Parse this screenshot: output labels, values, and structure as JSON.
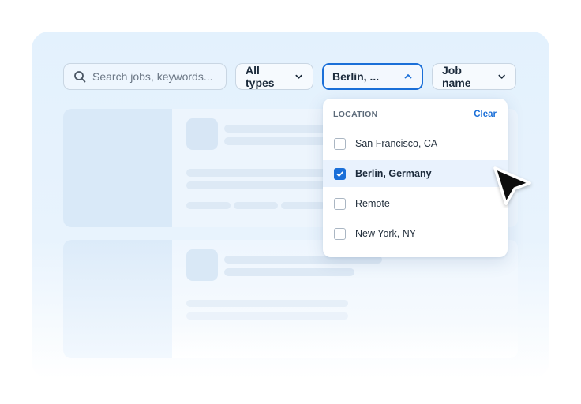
{
  "search": {
    "placeholder": "Search jobs, keywords..."
  },
  "filters": {
    "types_label": "All types",
    "location_label": "Berlin, ...",
    "jobname_label": "Job name"
  },
  "dropdown": {
    "title": "LOCATION",
    "clear_label": "Clear",
    "options": [
      {
        "label": "San Francisco, CA",
        "checked": false
      },
      {
        "label": "Berlin, Germany",
        "checked": true
      },
      {
        "label": "Remote",
        "checked": false
      },
      {
        "label": "New York, NY",
        "checked": false
      }
    ]
  },
  "colors": {
    "accent": "#1a6fd8",
    "card_bg": "#e3f1fd",
    "text": "#1b2a3b"
  },
  "icons": [
    "search-icon",
    "chevron-down-icon",
    "chevron-up-icon",
    "checkmark-icon",
    "cursor-pointer-icon"
  ]
}
